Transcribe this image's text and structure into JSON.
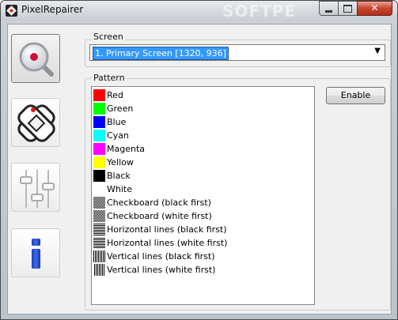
{
  "window": {
    "title": "PixelRepairer",
    "watermark": "SOFTPE"
  },
  "caption_buttons": {
    "minimize": "–",
    "maximize": "□",
    "close": "✕"
  },
  "sidebar": [
    {
      "icon": "magnifier-icon",
      "active": true
    },
    {
      "icon": "bandage-icon",
      "active": false
    },
    {
      "icon": "sliders-icon",
      "active": false
    },
    {
      "icon": "info-icon",
      "active": false
    }
  ],
  "screen": {
    "label": "Screen",
    "selected": "1. Primary Screen [1320, 936]"
  },
  "pattern": {
    "label": "Pattern",
    "enable_label": "Enable",
    "items": [
      {
        "label": "Red",
        "swatch": "#ff0000"
      },
      {
        "label": "Green",
        "swatch": "#00ff00"
      },
      {
        "label": "Blue",
        "swatch": "#0000ff"
      },
      {
        "label": "Cyan",
        "swatch": "#00ffff"
      },
      {
        "label": "Magenta",
        "swatch": "#ff00ff"
      },
      {
        "label": "Yellow",
        "swatch": "#ffff00"
      },
      {
        "label": "Black",
        "swatch": "#000000"
      },
      {
        "label": "White",
        "swatch": "#ffffff"
      },
      {
        "label": "Checkboard (black first)",
        "swatch": "checker-black"
      },
      {
        "label": "Checkboard (white first)",
        "swatch": "checker-white"
      },
      {
        "label": "Horizontal lines (black first)",
        "swatch": "hlines-black"
      },
      {
        "label": "Horizontal lines (white first)",
        "swatch": "hlines-white"
      },
      {
        "label": "Vertical lines (black first)",
        "swatch": "vlines-black"
      },
      {
        "label": "Vertical lines (white first)",
        "swatch": "vlines-white"
      }
    ]
  }
}
